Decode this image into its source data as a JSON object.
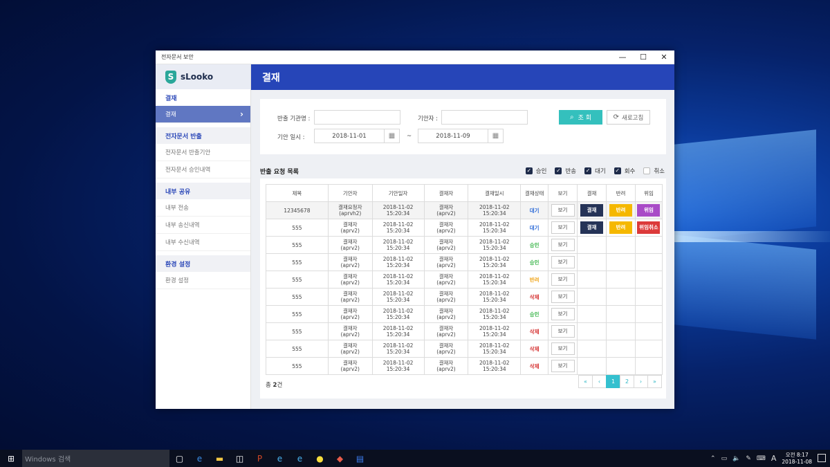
{
  "window": {
    "title": "전자문서 보안"
  },
  "window_controls": {
    "minimize": "—",
    "maximize": "☐",
    "close": "✕"
  },
  "logo": {
    "text": "sLooko",
    "mark": "S"
  },
  "sidebar": {
    "sections": [
      {
        "title": "결재",
        "items": [
          {
            "label": "결재",
            "active": true
          }
        ]
      },
      {
        "title": "전자문서 반출",
        "items": [
          {
            "label": "전자문서 반출기안"
          },
          {
            "label": "전자문서 승인내역"
          }
        ]
      },
      {
        "title": "내부 공유",
        "items": [
          {
            "label": "내부 전송"
          },
          {
            "label": "내부 송신내역"
          },
          {
            "label": "내부 수신내역"
          }
        ]
      },
      {
        "title": "환경 설정",
        "items": [
          {
            "label": "환경 설정"
          }
        ]
      }
    ],
    "active_arrow": "›"
  },
  "header": {
    "title": "결재"
  },
  "search": {
    "org_label": "반출 기관명 :",
    "org_value": "",
    "drafter_label": "기안자 :",
    "drafter_value": "",
    "date_label": "기안 일시 :",
    "date_from": "2018-11-01",
    "date_to": "2018-11-09",
    "tilde": "~",
    "search_button": "조 회",
    "refresh_button": "새로고침",
    "icons": {
      "search": "search-icon",
      "refresh": "refresh-icon",
      "calendar": "calendar-icon"
    }
  },
  "list": {
    "title": "반출 요청 목록",
    "filters": [
      {
        "label": "승인",
        "checked": true
      },
      {
        "label": "반송",
        "checked": true
      },
      {
        "label": "대기",
        "checked": true
      },
      {
        "label": "회수",
        "checked": true
      },
      {
        "label": "취소",
        "checked": false
      }
    ],
    "columns": [
      "제목",
      "기안자",
      "기안일자",
      "결재자",
      "결재일시",
      "결재상태",
      "보기",
      "결재",
      "반려",
      "위임"
    ],
    "view_label": "보기",
    "rows": [
      {
        "title": "12345678",
        "drafter": "결재요청자",
        "drafter_id": "(aprvh2)",
        "draft_date": "2018-11-02",
        "draft_time": "15:20:34",
        "approver": "결재자",
        "approver_id": "(aprv2)",
        "approve_date": "2018-11-02",
        "approve_time": "15:20:34",
        "status": "대기",
        "status_color": "blue",
        "approve": "결재",
        "reject": "반려",
        "delegate": "위임",
        "delegate_color": "purple"
      },
      {
        "title": "555",
        "drafter": "결재자",
        "drafter_id": "(aprv2)",
        "draft_date": "2018-11-02",
        "draft_time": "15:20:34",
        "approver": "결재자",
        "approver_id": "(aprv2)",
        "approve_date": "2018-11-02",
        "approve_time": "15:20:34",
        "status": "대기",
        "status_color": "blue",
        "approve": "결재",
        "reject": "반려",
        "delegate": "위임취소",
        "delegate_color": "red"
      },
      {
        "title": "555",
        "drafter": "결재자",
        "drafter_id": "(aprv2)",
        "draft_date": "2018-11-02",
        "draft_time": "15:20:34",
        "approver": "결재자",
        "approver_id": "(aprv2)",
        "approve_date": "2018-11-02",
        "approve_time": "15:20:34",
        "status": "승인",
        "status_color": "green"
      },
      {
        "title": "555",
        "drafter": "결재자",
        "drafter_id": "(aprv2)",
        "draft_date": "2018-11-02",
        "draft_time": "15:20:34",
        "approver": "결재자",
        "approver_id": "(aprv2)",
        "approve_date": "2018-11-02",
        "approve_time": "15:20:34",
        "status": "승인",
        "status_color": "green"
      },
      {
        "title": "555",
        "drafter": "결재자",
        "drafter_id": "(aprv2)",
        "draft_date": "2018-11-02",
        "draft_time": "15:20:34",
        "approver": "결재자",
        "approver_id": "(aprv2)",
        "approve_date": "2018-11-02",
        "approve_time": "15:20:34",
        "status": "반려",
        "status_color": "orange"
      },
      {
        "title": "555",
        "drafter": "결재자",
        "drafter_id": "(aprv2)",
        "draft_date": "2018-11-02",
        "draft_time": "15:20:34",
        "approver": "결재자",
        "approver_id": "(aprv2)",
        "approve_date": "2018-11-02",
        "approve_time": "15:20:34",
        "status": "삭제",
        "status_color": "red"
      },
      {
        "title": "555",
        "drafter": "결재자",
        "drafter_id": "(aprv2)",
        "draft_date": "2018-11-02",
        "draft_time": "15:20:34",
        "approver": "결재자",
        "approver_id": "(aprv2)",
        "approve_date": "2018-11-02",
        "approve_time": "15:20:34",
        "status": "승인",
        "status_color": "green"
      },
      {
        "title": "555",
        "drafter": "결재자",
        "drafter_id": "(aprv2)",
        "draft_date": "2018-11-02",
        "draft_time": "15:20:34",
        "approver": "결재자",
        "approver_id": "(aprv2)",
        "approve_date": "2018-11-02",
        "approve_time": "15:20:34",
        "status": "삭제",
        "status_color": "red"
      },
      {
        "title": "555",
        "drafter": "결재자",
        "drafter_id": "(aprv2)",
        "draft_date": "2018-11-02",
        "draft_time": "15:20:34",
        "approver": "결재자",
        "approver_id": "(aprv2)",
        "approve_date": "2018-11-02",
        "approve_time": "15:20:34",
        "status": "삭제",
        "status_color": "red"
      },
      {
        "title": "555",
        "drafter": "결재자",
        "drafter_id": "(aprv2)",
        "draft_date": "2018-11-02",
        "draft_time": "15:20:34",
        "approver": "결재자",
        "approver_id": "(aprv2)",
        "approve_date": "2018-11-02",
        "approve_time": "15:20:34",
        "status": "삭제",
        "status_color": "red"
      }
    ],
    "total_prefix": "총 ",
    "total_count": "2",
    "total_suffix": "건",
    "pagination": [
      "«",
      "‹",
      "1",
      "2",
      "›",
      "»"
    ],
    "current_page": "1"
  },
  "taskbar": {
    "search_placeholder": "Windows 검색",
    "apps": [
      "task-view-icon",
      "edge-icon",
      "file-explorer-icon",
      "store-icon",
      "powerpoint-icon",
      "ie-icon",
      "ie-icon",
      "kakaotalk-icon",
      "paint-icon",
      "docs-icon"
    ],
    "tray_ime": "A",
    "clock_time": "오전 8:17",
    "clock_date": "2018-11-08"
  },
  "colors": {
    "header": "#2645b8",
    "accent": "#34c0bd",
    "sidebar_active": "#6077c2"
  }
}
